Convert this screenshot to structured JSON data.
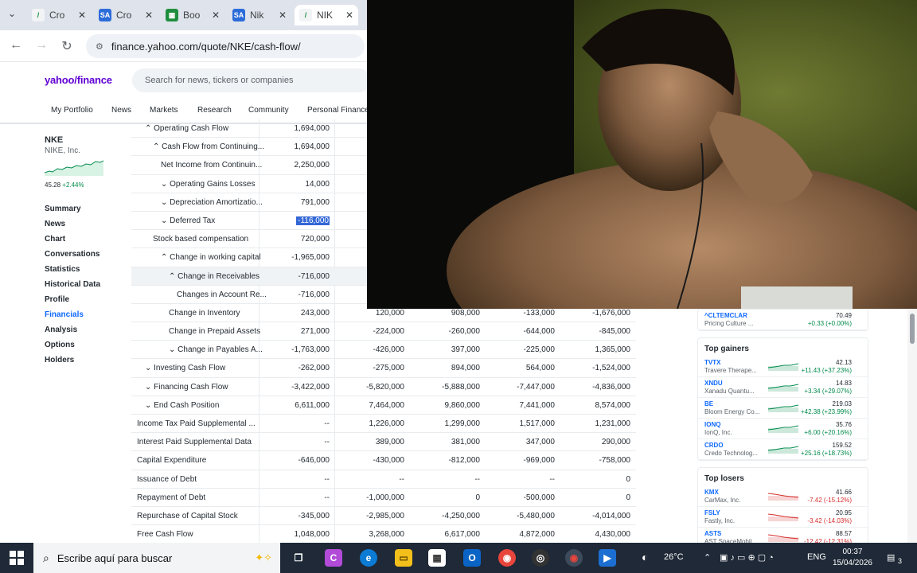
{
  "browser": {
    "tabs": [
      {
        "label": "Cro",
        "icon": "pencil-icon",
        "active": false
      },
      {
        "label": "Cro",
        "icon": "sa-icon",
        "active": false
      },
      {
        "label": "Boo",
        "icon": "sheets-icon",
        "active": false
      },
      {
        "label": "Nik",
        "icon": "sa-icon",
        "active": false
      },
      {
        "label": "NIK",
        "icon": "pencil-icon",
        "active": true
      }
    ],
    "url": "finance.yahoo.com/quote/NKE/cash-flow/"
  },
  "header": {
    "logo": "yahoo/finance",
    "search_placeholder": "Search for news, tickers or companies"
  },
  "topnav": [
    "My Portfolio",
    "News",
    "Markets",
    "Research",
    "Community",
    "Personal Finance"
  ],
  "quote": {
    "ticker": "NKE",
    "company": "NIKE, Inc.",
    "price": "45.28",
    "change": "+2.44%"
  },
  "leftnav": [
    "Summary",
    "News",
    "Chart",
    "Conversations",
    "Statistics",
    "Historical Data",
    "Profile",
    "Financials",
    "Analysis",
    "Options",
    "Holders"
  ],
  "leftnav_active": "Financials",
  "table": {
    "rows": [
      {
        "label": "⌃ Operating Cash Flow",
        "indent": 1,
        "values": [
          "1,694,000",
          "",
          "",
          "",
          ""
        ]
      },
      {
        "label": "⌃ Cash Flow from Continuing...",
        "indent": 2,
        "values": [
          "1,694,000",
          "",
          "",
          "",
          ""
        ]
      },
      {
        "label": "Net Income from Continuin...",
        "indent": 3,
        "values": [
          "2,250,000",
          "",
          "",
          "",
          ""
        ]
      },
      {
        "label": "⌄ Operating Gains Losses",
        "indent": 3,
        "values": [
          "14,000",
          "",
          "",
          "",
          ""
        ]
      },
      {
        "label": "⌄ Depreciation Amortizatio...",
        "indent": 3,
        "values": [
          "791,000",
          "",
          "",
          "",
          ""
        ]
      },
      {
        "label": "⌄ Deferred Tax",
        "indent": 3,
        "values": [
          "-116,000",
          "",
          "",
          "",
          ""
        ]
      },
      {
        "label": "Stock based compensation",
        "indent": 2,
        "values": [
          "720,000",
          "",
          "",
          "",
          ""
        ]
      },
      {
        "label": "⌃ Change in working capital",
        "indent": 3,
        "values": [
          "-1,965,000",
          "",
          "",
          "",
          ""
        ]
      },
      {
        "label": "⌃ Change in Receivables",
        "indent": 4,
        "values": [
          "-716,000",
          "",
          "",
          "",
          ""
        ]
      },
      {
        "label": "Changes in Account Re...",
        "indent": 5,
        "values": [
          "-716,000",
          "",
          "",
          "",
          ""
        ]
      },
      {
        "label": "Change in Inventory",
        "indent": 4,
        "values": [
          "243,000",
          "120,000",
          "908,000",
          "-133,000",
          "-1,676,000"
        ]
      },
      {
        "label": "Change in Prepaid Assets",
        "indent": 4,
        "values": [
          "271,000",
          "-224,000",
          "-260,000",
          "-644,000",
          "-845,000"
        ]
      },
      {
        "label": "⌄ Change in Payables A...",
        "indent": 4,
        "values": [
          "-1,763,000",
          "-426,000",
          "397,000",
          "-225,000",
          "1,365,000"
        ]
      },
      {
        "label": "⌄ Investing Cash Flow",
        "indent": 1,
        "values": [
          "-262,000",
          "-275,000",
          "894,000",
          "564,000",
          "-1,524,000"
        ]
      },
      {
        "label": "⌄ Financing Cash Flow",
        "indent": 1,
        "values": [
          "-3,422,000",
          "-5,820,000",
          "-5,888,000",
          "-7,447,000",
          "-4,836,000"
        ]
      },
      {
        "label": "⌄ End Cash Position",
        "indent": 1,
        "values": [
          "6,611,000",
          "7,464,000",
          "9,860,000",
          "7,441,000",
          "8,574,000"
        ]
      },
      {
        "label": "Income Tax Paid Supplemental ...",
        "indent": 0,
        "values": [
          "--",
          "1,226,000",
          "1,299,000",
          "1,517,000",
          "1,231,000"
        ]
      },
      {
        "label": "Interest Paid Supplemental Data",
        "indent": 0,
        "values": [
          "--",
          "389,000",
          "381,000",
          "347,000",
          "290,000"
        ]
      },
      {
        "label": "Capital Expenditure",
        "indent": 0,
        "values": [
          "-646,000",
          "-430,000",
          "-812,000",
          "-969,000",
          "-758,000"
        ]
      },
      {
        "label": "Issuance of Debt",
        "indent": 0,
        "values": [
          "--",
          "--",
          "--",
          "--",
          "0"
        ]
      },
      {
        "label": "Repayment of Debt",
        "indent": 0,
        "values": [
          "--",
          "-1,000,000",
          "0",
          "-500,000",
          "0"
        ]
      },
      {
        "label": "Repurchase of Capital Stock",
        "indent": 0,
        "values": [
          "-345,000",
          "-2,985,000",
          "-4,250,000",
          "-5,480,000",
          "-4,014,000"
        ]
      },
      {
        "label": "Free Cash Flow",
        "indent": 0,
        "values": [
          "1,048,000",
          "3,268,000",
          "6,617,000",
          "4,872,000",
          "4,430,000"
        ]
      }
    ],
    "highlight_row": 8,
    "selected_cell": "-116,000"
  },
  "sidebar_right": {
    "top_item": {
      "sym": "^CLTEMCLAR",
      "name": "Pricing Culture ...",
      "price": "70.49",
      "chg": "+0.33 (+0.00%)",
      "color": "#008a4b"
    },
    "gainers_title": "Top gainers",
    "gainers": [
      {
        "sym": "TVTX",
        "name": "Travere Therape...",
        "price": "42.13",
        "chg": "+11.43 (+37.23%)"
      },
      {
        "sym": "XNDU",
        "name": "Xanadu Quantu...",
        "price": "14.83",
        "chg": "+3.34 (+29.07%)"
      },
      {
        "sym": "BE",
        "name": "Bloom Energy Co...",
        "price": "219.03",
        "chg": "+42.38 (+23.99%)"
      },
      {
        "sym": "IONQ",
        "name": "IonQ, Inc.",
        "price": "35.76",
        "chg": "+6.00 (+20.16%)"
      },
      {
        "sym": "CRDO",
        "name": "Credo Technolog...",
        "price": "159.52",
        "chg": "+25.16 (+18.73%)"
      }
    ],
    "losers_title": "Top losers",
    "losers": [
      {
        "sym": "KMX",
        "name": "CarMax, Inc.",
        "price": "41.66",
        "chg": "-7.42 (-15.12%)"
      },
      {
        "sym": "FSLY",
        "name": "Fastly, Inc.",
        "price": "20.95",
        "chg": "-3.42 (-14.03%)"
      },
      {
        "sym": "ASTS",
        "name": "AST SpaceMobil...",
        "price": "88.57",
        "chg": "-12.42 (-12.31%)"
      }
    ],
    "up_color": "#008a4b",
    "down_color": "#d62d2d"
  },
  "taskbar": {
    "search_placeholder": "Escribe aquí para buscar",
    "weather": "26°C",
    "lang": "ENG",
    "time": "00:37",
    "date": "15/04/2026",
    "notifications": "3"
  }
}
